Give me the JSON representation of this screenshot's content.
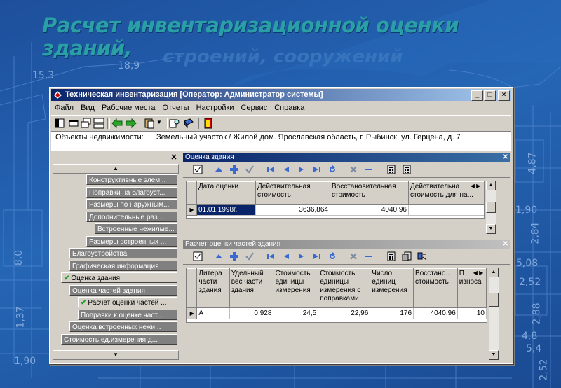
{
  "slide": {
    "title_line1": "Расчет инвентаризационной оценки зданий,",
    "title_line2": "строений, сооружений"
  },
  "blueprint_numbers": [
    "15,3",
    "18,9",
    "2,84",
    "4,87",
    "5,08",
    "1,90",
    "2,88",
    "2,52",
    "1,37",
    "8,0",
    "1,90",
    "4,8",
    "5,4",
    "2,52"
  ],
  "window": {
    "title": "Техническая инвентаризация [Оператор: Администратор системы]",
    "controls": [
      "_",
      "□",
      "×"
    ]
  },
  "menu": [
    "Файл",
    "Вид",
    "Рабочие места",
    "Отчеты",
    "Настройки",
    "Сервис",
    "Справка"
  ],
  "object_bar": {
    "label": "Объекты недвижимости:",
    "value": "Земельный участок / Жилой дом. Ярославская область, г. Рыбинск, ул. Герцена, д. 7"
  },
  "tree": {
    "items": [
      {
        "label": "Конструктивные элем...",
        "checked": false
      },
      {
        "label": "Поправки на благоуст...",
        "checked": false
      },
      {
        "label": "Размеры по наружным...",
        "checked": false
      },
      {
        "label": "Дополнительные раз...",
        "checked": false
      },
      {
        "label": "Встроенные нежилые...",
        "checked": false
      },
      {
        "label": "Размеры встроенных ...",
        "checked": false
      },
      {
        "label": "Благоустройства",
        "checked": false
      },
      {
        "label": "Графическая информация",
        "checked": false
      },
      {
        "label": "Оценка здания",
        "checked": true
      },
      {
        "label": "Оценка частей здания",
        "checked": false
      },
      {
        "label": "Расчет оценки частей ...",
        "checked": true
      },
      {
        "label": "Поправки к оценке част...",
        "checked": false
      },
      {
        "label": "Оценка встроенных нежи...",
        "checked": false
      },
      {
        "label": "Стоимость ед.измерения д...",
        "checked": false
      }
    ]
  },
  "panel1": {
    "title": "Оценка здания",
    "columns": [
      "Дата оценки",
      "Действительная стоимость",
      "Восстановительная стоимость",
      "Действительна стоимость для на..."
    ],
    "rows": [
      [
        "01.01.1998г.",
        "3636,864",
        "4040,96",
        ""
      ]
    ]
  },
  "panel2": {
    "title": "Расчет оценки частей здания",
    "columns": [
      "Литера части здания",
      "Удельный вес части здания",
      "Стоимость единицы измерения",
      "Стоимость единицы измерения с поправками",
      "Число единиц измерения",
      "Восстано... стоимость",
      "П износа"
    ],
    "rows": [
      [
        "А",
        "0,928",
        "24,5",
        "22,96",
        "176",
        "4040,96",
        "10"
      ]
    ]
  }
}
